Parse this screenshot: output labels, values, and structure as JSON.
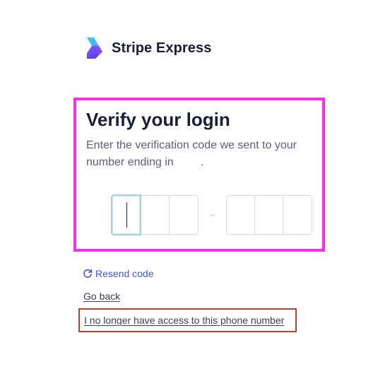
{
  "brand": {
    "logo_icon": "stripe-express-logo-icon",
    "name": "Stripe Express"
  },
  "verify": {
    "title": "Verify your login",
    "description_prefix": "Enter the verification code we sent to your number ending in",
    "description_suffix": ".",
    "code_separator": "-",
    "code_digits": [
      "",
      "",
      "",
      "",
      "",
      ""
    ]
  },
  "links": {
    "resend_icon": "refresh-icon",
    "resend_label": "Resend code",
    "go_back_label": "Go back",
    "no_access_label": "I no longer have access to this phone number"
  },
  "colors": {
    "highlight_box": "#ff2ee8",
    "no_access_box": "#a4492a",
    "link_blue": "#3d57c9",
    "input_focus": "#a7d1e8",
    "logo_purple": "#6d3cff",
    "logo_cyan": "#28c7e8"
  }
}
